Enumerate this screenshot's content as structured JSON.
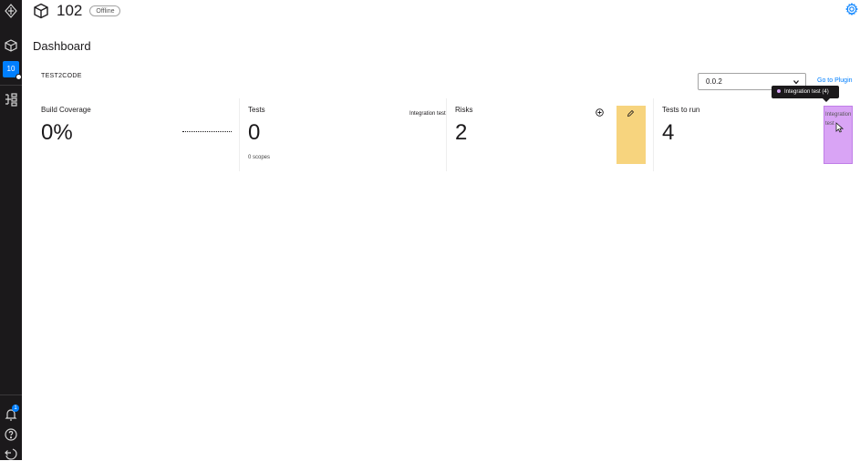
{
  "sidebar": {
    "agent_badge": "10",
    "notification_count": "1"
  },
  "header": {
    "title": "102",
    "status": "Offline"
  },
  "page": {
    "title": "Dashboard",
    "section": "TEST2CODE"
  },
  "version_select": {
    "value": "0.0.2"
  },
  "links": {
    "go_to_plugin": "Go to Plugin"
  },
  "tooltip": {
    "text": "Integration test (4)"
  },
  "cards": {
    "build_coverage": {
      "label": "Build Coverage",
      "value": "0%"
    },
    "tests": {
      "label": "Tests",
      "value": "0",
      "sub": "0 scopes"
    },
    "risks": {
      "label": "Risks",
      "value": "2",
      "legend": "Integration test"
    },
    "tests_to_run": {
      "label": "Tests to run",
      "value": "4",
      "bar_label": "Integration test"
    }
  },
  "colors": {
    "accent": "#007fff",
    "sidebar_bg": "#1b191b",
    "risk_bar": "#f7d47e",
    "integration_bar": "#d9a4f5"
  },
  "icons": [
    "logo-icon",
    "cube-icon",
    "plugins-icon",
    "bell-icon",
    "help-icon",
    "logout-icon",
    "settings-icon",
    "chevron-down-icon",
    "add-icon",
    "pencil-icon",
    "cursor-icon"
  ]
}
